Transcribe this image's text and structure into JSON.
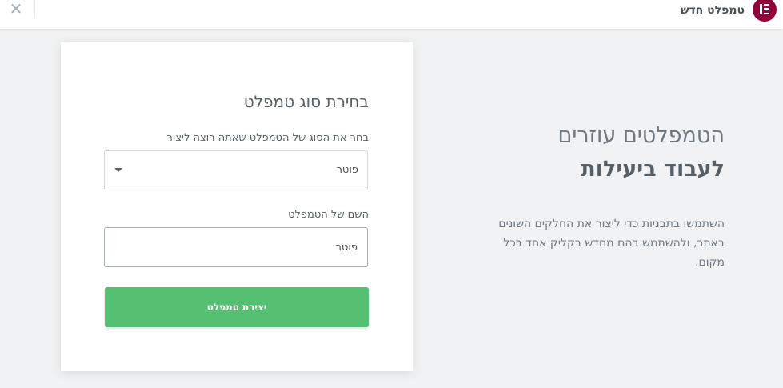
{
  "header": {
    "title": "טמפלט חדש",
    "close_glyph": "✕",
    "logo_icon": "elementor-logo-icon",
    "logo_color": "#92003b"
  },
  "card": {
    "title": "בחירת סוג טמפלט",
    "type_label": "בחר את הסוג של הטמפלט שאתה רוצה ליצור",
    "type_selected": "פוטר",
    "name_label": "השם של הטמפלט",
    "name_value": "פוטר",
    "create_button": "יצירת טמפלט",
    "button_color": "#55c071"
  },
  "info": {
    "heading_line1": "הטמפלטים עוזרים",
    "heading_line2": "לעבוד ביעילות",
    "body": "השתמשו בתבניות כדי ליצור את החלקים השונים באתר, ולהשתמש בהם מחדש בקליק אחד בכל מקום."
  }
}
